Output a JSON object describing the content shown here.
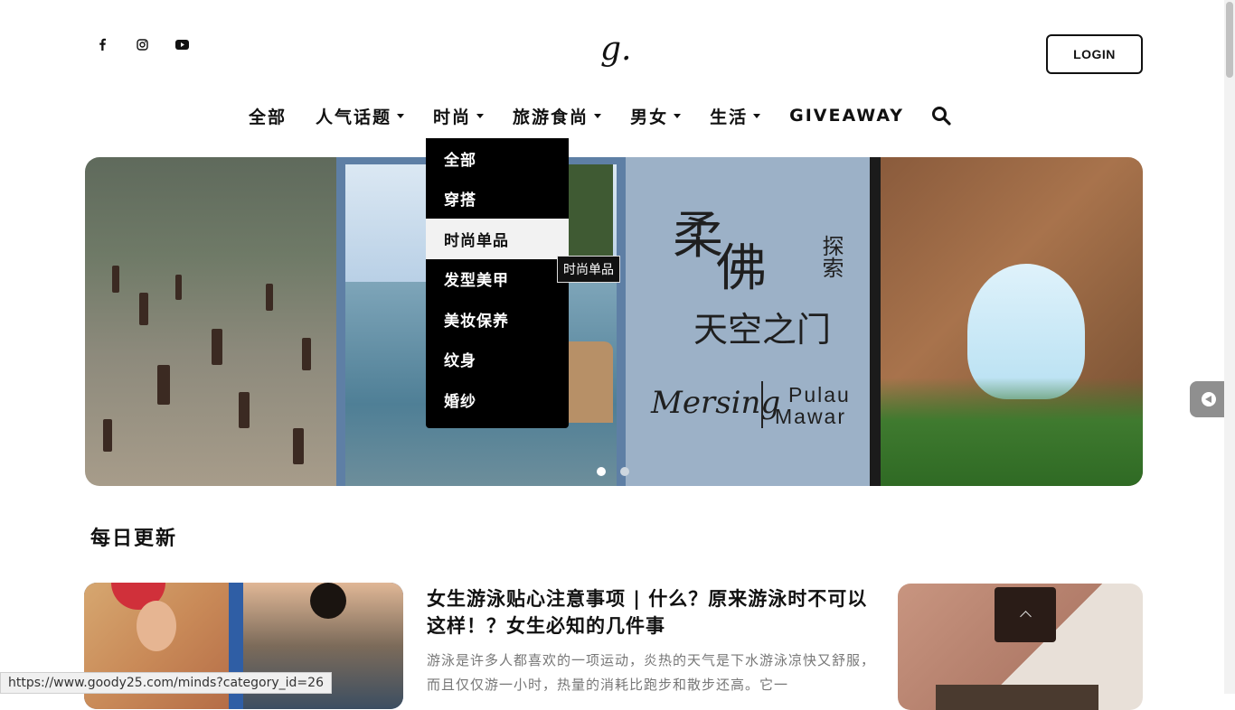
{
  "header": {
    "social": [
      {
        "icon": "facebook-icon"
      },
      {
        "icon": "instagram-icon"
      },
      {
        "icon": "youtube-icon"
      }
    ],
    "logo": "g.",
    "login_label": "LOGIN"
  },
  "nav": {
    "items": [
      {
        "label": "全部"
      },
      {
        "label": "人气话题"
      },
      {
        "label": "时尚"
      },
      {
        "label": "旅游食尚"
      },
      {
        "label": "男女"
      },
      {
        "label": "生活"
      },
      {
        "label": "GIVEAWAY"
      }
    ],
    "search_icon": "search-icon"
  },
  "dropdown": {
    "items": [
      {
        "label": "全部"
      },
      {
        "label": "穿搭"
      },
      {
        "label": "时尚单品"
      },
      {
        "label": "发型美甲"
      },
      {
        "label": "美妆保养"
      },
      {
        "label": "纹身"
      },
      {
        "label": "婚纱"
      }
    ],
    "tooltip": "时尚单品"
  },
  "slider": {
    "title_line1a": "柔",
    "title_line1b": "佛",
    "title_side": "探索",
    "title_line2": "天空之门",
    "script": "Mersing",
    "place_line1": "Pulau",
    "place_line2": "Mawar",
    "active_slide": 1,
    "slide_count": 2
  },
  "section": {
    "title": "每日更新"
  },
  "article": {
    "title": "女生游泳贴心注意事项 | 什么？原来游泳时不可以这样！？女生必知的几件事",
    "excerpt": "游泳是许多人都喜欢的一项运动，炎热的天气是下水游泳凉快又舒服，而且仅仅游一小时，热量的消耗比跑步和散步还高。它一"
  },
  "status_url": "https://www.goody25.com/minds?category_id=26",
  "colors": {
    "accent": "#000000",
    "nav_text": "#111111",
    "dropdown_bg": "#000000",
    "dropdown_hover": "#f2f2f2",
    "excerpt_text": "#777777"
  }
}
